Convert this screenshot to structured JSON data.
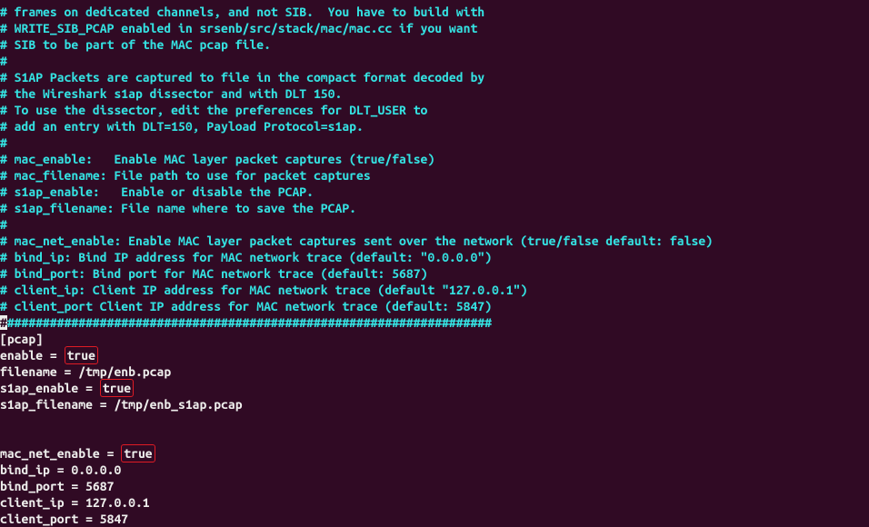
{
  "comments": {
    "c1": "# frames on dedicated channels, and not SIB.  You have to build with",
    "c2": "# WRITE_SIB_PCAP enabled in srsenb/src/stack/mac/mac.cc if you want",
    "c3": "# SIB to be part of the MAC pcap file.",
    "c4": "#",
    "c5": "# S1AP Packets are captured to file in the compact format decoded by",
    "c6": "# the Wireshark s1ap dissector and with DLT 150.",
    "c7": "# To use the dissector, edit the preferences for DLT_USER to",
    "c8": "# add an entry with DLT=150, Payload Protocol=s1ap.",
    "c9": "#",
    "c10": "# mac_enable:   Enable MAC layer packet captures (true/false)",
    "c11": "# mac_filename: File path to use for packet captures",
    "c12": "# s1ap_enable:   Enable or disable the PCAP.",
    "c13": "# s1ap_filename: File name where to save the PCAP.",
    "c14": "#",
    "c15": "# mac_net_enable: Enable MAC layer packet captures sent over the network (true/false default: false)",
    "c16": "# bind_ip: Bind IP address for MAC network trace (default: \"0.0.0.0\")",
    "c17": "# bind_port: Bind port for MAC network trace (default: 5687)",
    "c18": "# client_ip: Client IP address for MAC network trace (default \"127.0.0.1\")",
    "c19": "# client_port Client IP address for MAC network trace (default: 5847)",
    "c20_cursor": "#",
    "c20_rest": "####################################################################"
  },
  "config": {
    "section": "[pcap]",
    "enable_key": "enable = ",
    "enable_val": "true",
    "filename": "filename = /tmp/enb.pcap",
    "s1ap_enable_key": "s1ap_enable = ",
    "s1ap_enable_val": "true",
    "s1ap_filename": "s1ap_filename = /tmp/enb_s1ap.pcap",
    "mac_net_enable_key": "mac_net_enable = ",
    "mac_net_enable_val": "true",
    "bind_ip": "bind_ip = 0.0.0.0",
    "bind_port": "bind_port = 5687",
    "client_ip": "client_ip = 127.0.0.1",
    "client_port": "client_port = 5847"
  },
  "highlights": {
    "enable": true,
    "s1ap_enable": true,
    "mac_net_enable": true
  },
  "chart_data": {
    "type": "table",
    "title": "srsenb pcap configuration",
    "rows": [
      {
        "key": "enable",
        "value": "true"
      },
      {
        "key": "filename",
        "value": "/tmp/enb.pcap"
      },
      {
        "key": "s1ap_enable",
        "value": "true"
      },
      {
        "key": "s1ap_filename",
        "value": "/tmp/enb_s1ap.pcap"
      },
      {
        "key": "mac_net_enable",
        "value": "true"
      },
      {
        "key": "bind_ip",
        "value": "0.0.0.0"
      },
      {
        "key": "bind_port",
        "value": "5687"
      },
      {
        "key": "client_ip",
        "value": "127.0.0.1"
      },
      {
        "key": "client_port",
        "value": "5847"
      }
    ]
  }
}
